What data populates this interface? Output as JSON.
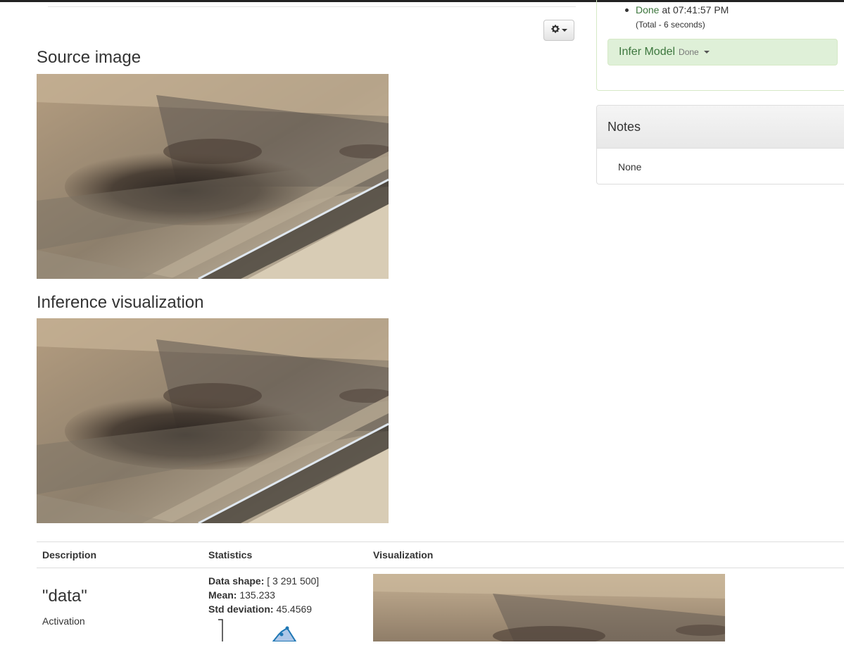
{
  "header": {
    "settings_icon": "gear-icon"
  },
  "sections": {
    "source_title": "Source image",
    "inference_title": "Inference visualization"
  },
  "job_status": {
    "state": "Done",
    "time_prefix": "at",
    "time": "07:41:57 PM",
    "total": "(Total - 6 seconds)",
    "task_label": "Infer Model",
    "task_state": "Done"
  },
  "notes": {
    "title": "Notes",
    "body": "None"
  },
  "results_table": {
    "columns": [
      "Description",
      "Statistics",
      "Visualization"
    ],
    "rows": [
      {
        "name": "\"data\"",
        "kind": "Activation",
        "shape_label": "Data shape:",
        "shape_value": "[ 3 291 500]",
        "mean_label": "Mean:",
        "mean_value": "135.233",
        "std_label": "Std deviation:",
        "std_value": "45.4569"
      }
    ]
  },
  "colors": {
    "success_text": "#3c763d",
    "success_bg": "#dff0d8",
    "histogram": "#1f77b4"
  }
}
